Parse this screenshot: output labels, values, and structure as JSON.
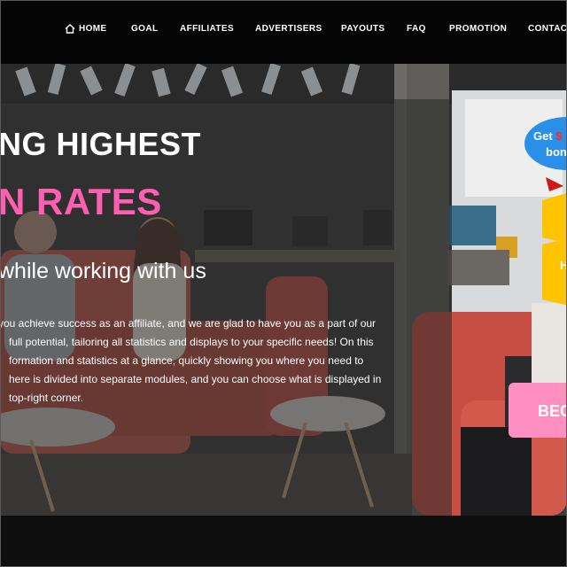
{
  "nav": {
    "items": [
      "HOME",
      "GOAL",
      "AFFILIATES",
      "ADVERTISERS",
      "PAYOUTS",
      "FAQ",
      "PROMOTION",
      "CONTACT"
    ],
    "home_icon": "home-icon"
  },
  "hero": {
    "headline_line1": "NG HIGHEST",
    "headline_line2": "N RATES",
    "subheading": "while working with us",
    "body_lines": [
      "you achieve success as an affiliate, and we are glad to have you as a part of our",
      "full potential, tailoring all statistics and displays to your specific needs! On this",
      "formation and statistics at a glance, quickly showing you where you need to",
      "here is divided into separate modules, and you can choose what is displayed in",
      "top-right corner."
    ]
  },
  "promo": {
    "bonus_prefix": "Get ",
    "bonus_amount": "$",
    "bonus_suffix": "bon",
    "ribbon_text": "H",
    "become_button": "BEC"
  },
  "colors": {
    "accent_pink": "#ff5fb0",
    "button_pink": "#ff8fc0",
    "bubble_blue": "#2a8fe8",
    "ribbon_yellow": "#ffc400",
    "navbar_bg": "#050505"
  }
}
